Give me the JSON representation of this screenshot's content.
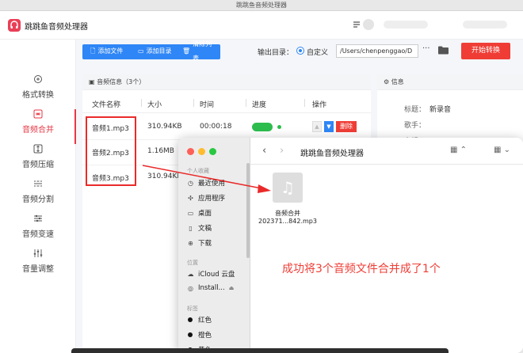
{
  "window": {
    "title": "跳跳鱼音频处理器"
  },
  "app": {
    "name": "跳跳鱼音频处理器"
  },
  "sidebar": {
    "items": [
      {
        "label": "格式转换",
        "icon": "format-icon"
      },
      {
        "label": "音频合并",
        "icon": "merge-icon",
        "active": true
      },
      {
        "label": "音频压缩",
        "icon": "compress-icon"
      },
      {
        "label": "音频分割",
        "icon": "split-icon"
      },
      {
        "label": "音频变速",
        "icon": "speed-icon"
      },
      {
        "label": "音量调整",
        "icon": "volume-icon"
      }
    ]
  },
  "toolbar": {
    "add_file": "添加文件",
    "add_dir": "添加目录",
    "clear_list": "清除列表",
    "output_label": "输出目录：",
    "custom_label": "自定义",
    "output_path": "/Users/chenpenggao/D",
    "more": "···",
    "start": "开始转换"
  },
  "file_panel": {
    "title": "音频信息（3个）",
    "columns": [
      "文件名称",
      "大小",
      "时间",
      "进度",
      "操作"
    ],
    "rows": [
      {
        "name": "音频1.mp3",
        "size": "310.94KB",
        "time": "00:00:18",
        "progress_done": true,
        "delete": "删除"
      },
      {
        "name": "音频2.mp3",
        "size": "1.16MB",
        "time": "",
        "progress_done": false,
        "delete": ""
      },
      {
        "name": "音频3.mp3",
        "size": "310.94KE",
        "time": "",
        "progress_done": false,
        "delete": ""
      }
    ]
  },
  "info_panel": {
    "title": "信息",
    "title_label": "标题：",
    "title_value": "新录音",
    "artist_label": "歌手：",
    "album_label": "专辑"
  },
  "finder": {
    "title": "跳跳鱼音频处理器",
    "favorites_label": "个人收藏",
    "locations_label": "位置",
    "tags_label": "标签",
    "favorites": [
      {
        "label": "最近使用",
        "icon": "clock-icon"
      },
      {
        "label": "应用程序",
        "icon": "apps-icon"
      },
      {
        "label": "桌面",
        "icon": "desktop-icon"
      },
      {
        "label": "文稿",
        "icon": "document-icon"
      },
      {
        "label": "下载",
        "icon": "download-icon"
      }
    ],
    "locations": [
      {
        "label": "iCloud 云盘",
        "icon": "cloud-icon"
      },
      {
        "label": "Install...",
        "icon": "disk-icon"
      }
    ],
    "tags": [
      "红色",
      "橙色",
      "黄色"
    ],
    "file": {
      "name_line1": "音频合并",
      "name_line2": "202371...842.mp3",
      "icon": "music-note-icon"
    },
    "note": "成功将3个音频文件合并成了1个"
  },
  "colors": {
    "accent_red": "#ef3d36",
    "accent_blue": "#2f86f6",
    "success_green": "#2dbd4e"
  }
}
